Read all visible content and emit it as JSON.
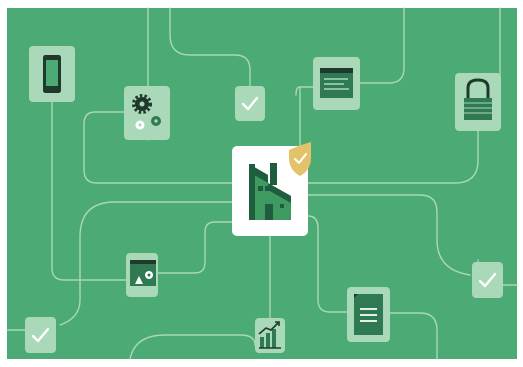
{
  "illustration": {
    "colors": {
      "frame": "#ffffff",
      "background": "#4caa74",
      "line": "#a8d8b8",
      "tile": "#a9d9b8",
      "tile_dark": "#2f7a52",
      "center_tile": "#ffffff",
      "factory_dark": "#1f5e3c",
      "factory_light": "#3f9a62",
      "shield": "#e3c26a",
      "white": "#ffffff",
      "dark": "#1f3a2c"
    },
    "icons": [
      "smartphone-icon",
      "gears-icon",
      "checkmark-icon",
      "browser-window-icon",
      "padlock-icon",
      "factory-icon",
      "shield-check-icon",
      "settings-window-icon",
      "chart-icon",
      "document-icon"
    ]
  }
}
